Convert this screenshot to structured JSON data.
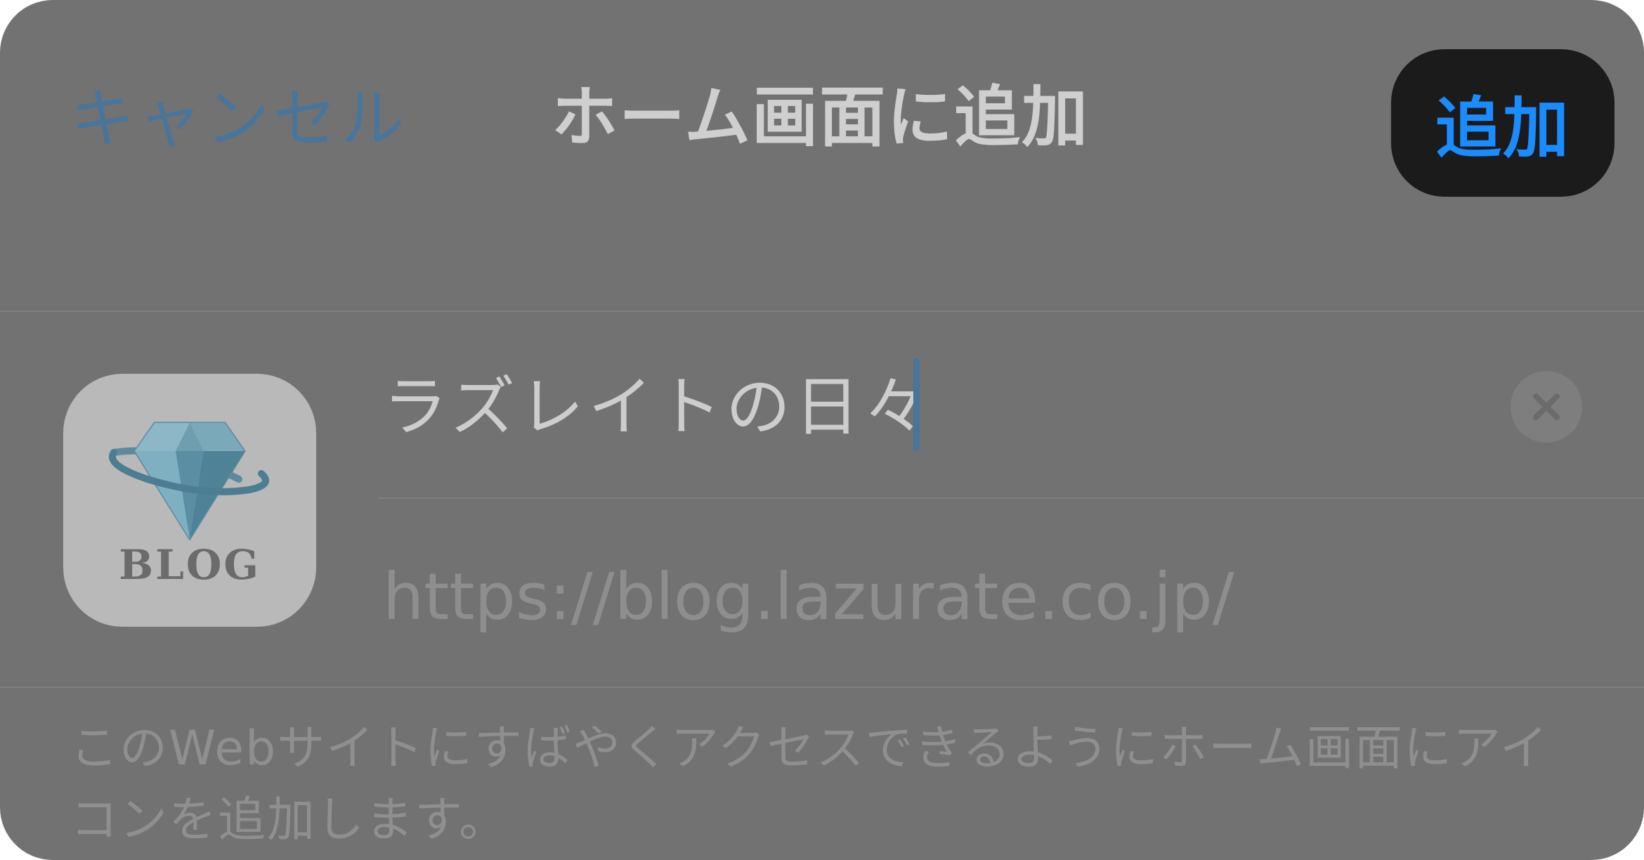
{
  "nav": {
    "cancel_label": "キャンセル",
    "title": "ホーム画面に追加",
    "add_label": "追加"
  },
  "bookmark": {
    "icon_text": "BLOG",
    "name_value": "ラズレイトの日々",
    "url": "https://blog.lazurate.co.jp/"
  },
  "footer": {
    "description": "このWebサイトにすばやくアクセスできるようにホーム画面にアイコンを追加します。"
  },
  "icons": {
    "app_icon": "gem-planet-icon",
    "clear": "clear-circle-x-icon"
  },
  "colors": {
    "accent_blue": "#1a8cff",
    "dimmed_link": "#4a759a",
    "sheet_background": "#727272",
    "add_button_background": "#1b1b1b"
  }
}
